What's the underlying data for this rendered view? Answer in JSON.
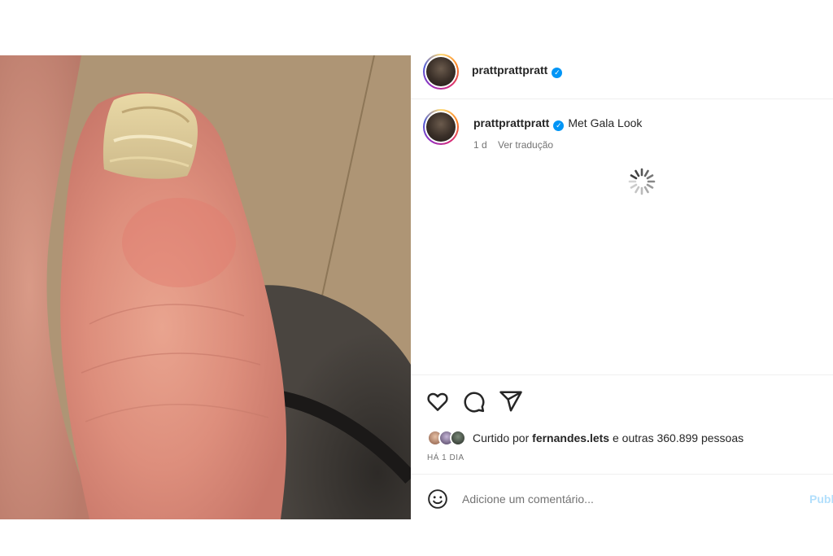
{
  "post": {
    "image_alt": "close-up of big toe with thickened yellowish toenail"
  },
  "header": {
    "username": "prattprattpratt",
    "verified_symbol": "✓"
  },
  "caption": {
    "username": "prattprattpratt",
    "text": "Met Gala Look",
    "time": "1 d",
    "translate_label": "Ver tradução"
  },
  "likes": {
    "prefix": "Curtido por",
    "user": "fernandes.lets",
    "suffix": "e outras 360.899 pessoas"
  },
  "time_ago": "HÁ 1 DIA",
  "comment": {
    "placeholder": "Adicione um comentário...",
    "publish_label": "Publicar"
  },
  "icons": {
    "like": "heart-icon",
    "comment": "comment-icon",
    "share": "share-icon",
    "emoji": "emoji-icon",
    "loading": "loading-spinner-icon"
  },
  "colors": {
    "verified": "#0095f6",
    "publish_disabled": "#b2dffc",
    "muted_text": "#737373"
  }
}
